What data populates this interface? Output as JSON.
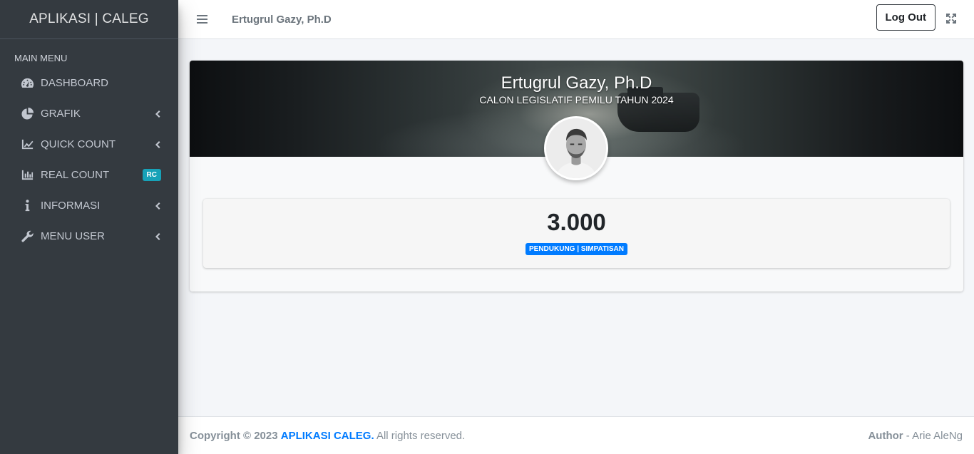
{
  "sidebar": {
    "brand": "APLIKASI | CALEG",
    "header": "MAIN MENU",
    "items": [
      {
        "label": "DASHBOARD",
        "icon": "tachometer-icon"
      },
      {
        "label": "GRAFIK",
        "icon": "pie-chart-icon"
      },
      {
        "label": "QUICK COUNT",
        "icon": "line-chart-icon"
      },
      {
        "label": "REAL COUNT",
        "icon": "bar-chart-icon",
        "badge": "RC"
      },
      {
        "label": "INFORMASI",
        "icon": "info-icon"
      },
      {
        "label": "MENU USER",
        "icon": "wrench-icon"
      }
    ]
  },
  "navbar": {
    "user_name": "Ertugrul Gazy, Ph.D",
    "logout_label": "Log Out"
  },
  "profile": {
    "name": "Ertugrul Gazy, Ph.D",
    "subtitle": "CALON LEGISLATIF PEMILU TAHUN 2024",
    "stat_value": "3.000",
    "stat_label": "PENDUKUNG | SIMPATISAN"
  },
  "footer": {
    "copyright_prefix": "Copyright © 2023",
    "app_link": "APLIKASI CALEG.",
    "rights": "All rights reserved.",
    "author_label": "Author",
    "author_sep": " - ",
    "author_name": "Arie AleNg"
  },
  "colors": {
    "sidebar_bg": "#343a40",
    "badge_rc": "#17a2b8",
    "badge_primary": "#007bff",
    "link": "#007bff"
  }
}
